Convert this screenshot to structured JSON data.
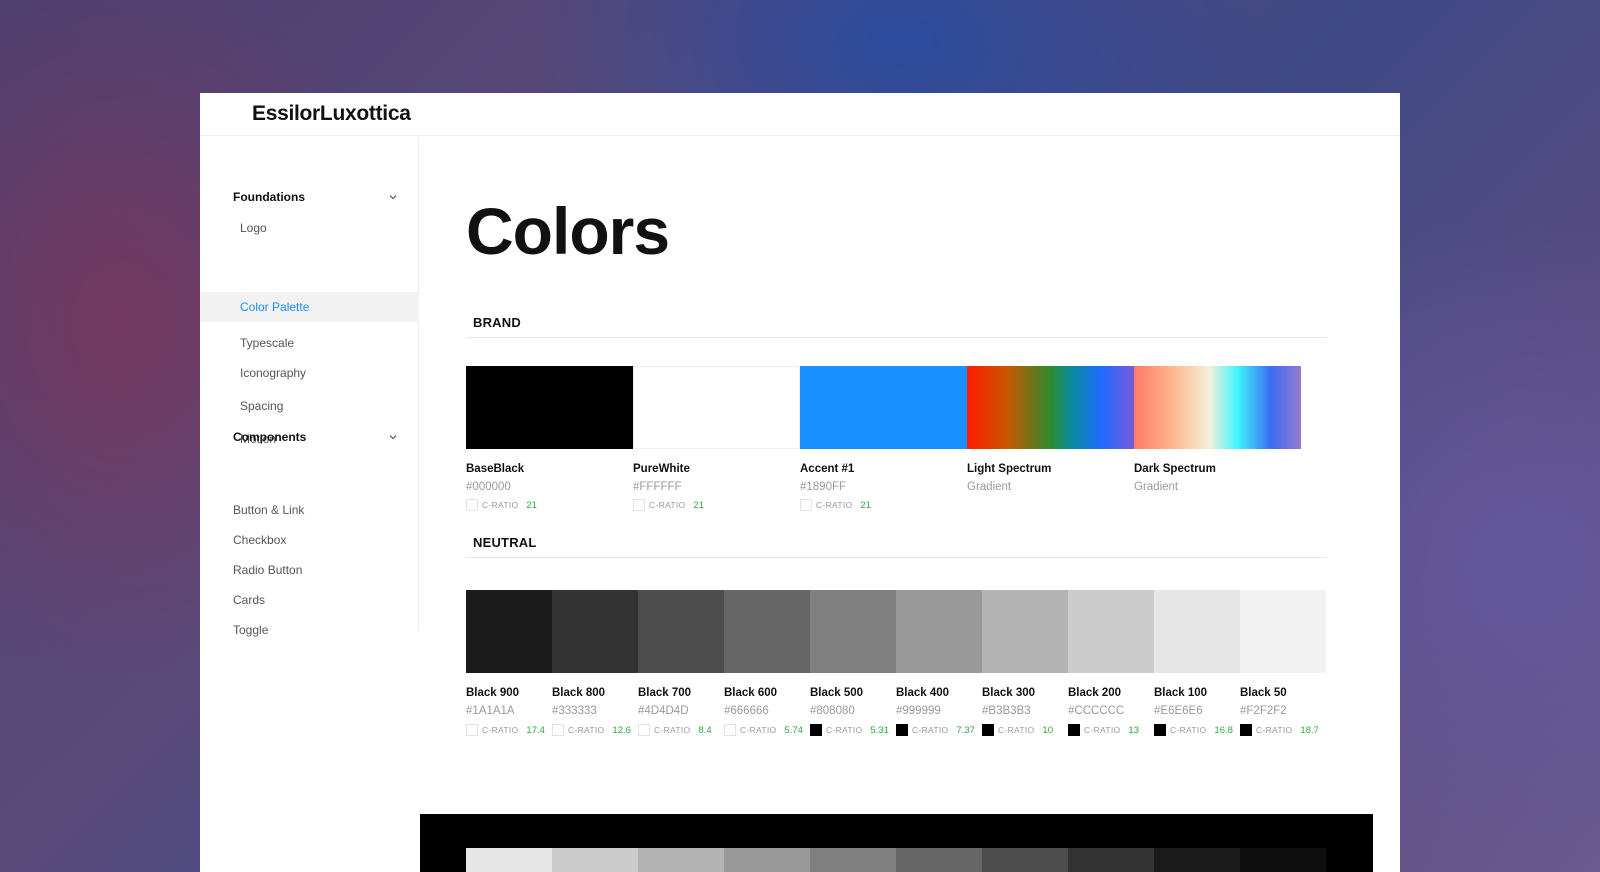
{
  "app": {
    "logo": "EssilorLuxottica"
  },
  "sidebar": {
    "sections": [
      {
        "label": "Foundations",
        "items": [
          "Logo",
          "Color Palette",
          "Typescale",
          "Iconography",
          "Spacing",
          "Motion"
        ]
      },
      {
        "label": "Components",
        "items": [
          "Button & Link",
          "Checkbox",
          "Radio Button",
          "Cards",
          "Toggle"
        ]
      }
    ],
    "active_item": "Color Palette"
  },
  "main": {
    "title": "Colors",
    "brand": {
      "heading": "BRAND",
      "swatches": [
        {
          "name": "BaseBlack",
          "value": "#000000",
          "color": "#000000",
          "ratio_label": "C-RATIO",
          "ratio": "21"
        },
        {
          "name": "PureWhite",
          "value": "#FFFFFF",
          "color": "#FFFFFF",
          "ratio_label": "C-RATIO",
          "ratio": "21"
        },
        {
          "name": "Accent #1",
          "value": "#1890FF",
          "color": "#1890FF",
          "ratio_label": "C-RATIO",
          "ratio": "21"
        },
        {
          "name": "Light Spectrum",
          "value": "Gradient"
        },
        {
          "name": "Dark Spectrum",
          "value": "Gradient"
        }
      ]
    },
    "neutral": {
      "heading": "NEUTRAL",
      "swatches": [
        {
          "name": "Black 900",
          "value": "#1A1A1A",
          "color": "#1A1A1A",
          "ratio_label": "C-RATIO",
          "ratio": "17.4",
          "box": "light"
        },
        {
          "name": "Black 800",
          "value": "#333333",
          "color": "#333333",
          "ratio_label": "C-RATIO",
          "ratio": "12.6",
          "box": "light"
        },
        {
          "name": "Black 700",
          "value": "#4D4D4D",
          "color": "#4D4D4D",
          "ratio_label": "C-RATIO",
          "ratio": "8.4",
          "box": "light"
        },
        {
          "name": "Black 600",
          "value": "#666666",
          "color": "#666666",
          "ratio_label": "C-RATIO",
          "ratio": "5.74",
          "box": "light"
        },
        {
          "name": "Black 500",
          "value": "#808080",
          "color": "#808080",
          "ratio_label": "C-RATIO",
          "ratio": "5.31",
          "box": "dark"
        },
        {
          "name": "Black 400",
          "value": "#999999",
          "color": "#999999",
          "ratio_label": "C-RATIO",
          "ratio": "7.37",
          "box": "dark"
        },
        {
          "name": "Black 300",
          "value": "#B3B3B3",
          "color": "#B3B3B3",
          "ratio_label": "C-RATIO",
          "ratio": "10",
          "box": "dark"
        },
        {
          "name": "Black 200",
          "value": "#CCCCCC",
          "color": "#CCCCCC",
          "ratio_label": "C-RATIO",
          "ratio": "13",
          "box": "dark"
        },
        {
          "name": "Black 100",
          "value": "#E6E6E6",
          "color": "#E6E6E6",
          "ratio_label": "C-RATIO",
          "ratio": "16.8",
          "box": "dark"
        },
        {
          "name": "Black 50",
          "value": "#F2F2F2",
          "color": "#F2F2F2",
          "ratio_label": "C-RATIO",
          "ratio": "18.7",
          "box": "dark"
        }
      ]
    },
    "dark_preview": {
      "colors": [
        "#E6E6E6",
        "#CCCCCC",
        "#B3B3B3",
        "#999999",
        "#808080",
        "#666666",
        "#4D4D4D",
        "#333333",
        "#1A1A1A",
        "#0F0F0F"
      ]
    }
  },
  "colors": {
    "accent": "#1890FF",
    "ratio_green": "#2EAA3B"
  }
}
